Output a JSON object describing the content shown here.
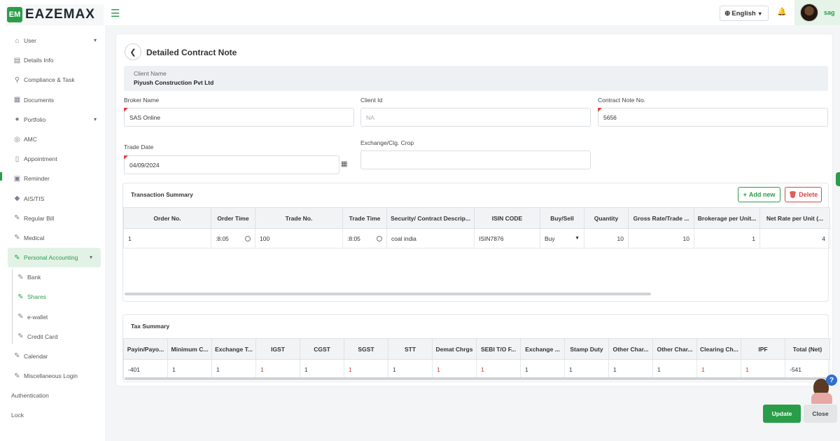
{
  "app": {
    "logo_text": "EAZEMAX",
    "logo_mark": "EM"
  },
  "sidebar": {
    "items": [
      {
        "label": "User",
        "icon": "user-home-icon"
      },
      {
        "label": "Details Info",
        "icon": "id-card-icon"
      },
      {
        "label": "Compliance & Task",
        "icon": "compliance-icon"
      },
      {
        "label": "Documents",
        "icon": "documents-icon"
      },
      {
        "label": "Portfolio",
        "icon": "user-icon"
      },
      {
        "label": "AMC",
        "icon": "amc-icon"
      },
      {
        "label": "Appointment",
        "icon": "appointment-icon"
      },
      {
        "label": "Reminder",
        "icon": "reminder-icon"
      },
      {
        "label": "AIS/TIS",
        "icon": "tag-icon"
      },
      {
        "label": "Regular Bill",
        "icon": "user-edit-icon"
      },
      {
        "label": "Medical",
        "icon": "user-edit-icon"
      },
      {
        "label": "Personal Accounting",
        "icon": "user-edit-icon"
      }
    ],
    "sub_items": [
      {
        "label": "Bank"
      },
      {
        "label": "Shares"
      },
      {
        "label": "e-wallet"
      },
      {
        "label": "Credit Card"
      }
    ],
    "bottom_items": [
      {
        "label": "Calendar"
      },
      {
        "label": "Miscellaneous Login"
      },
      {
        "label": "Authentication"
      },
      {
        "label": "Lock"
      }
    ]
  },
  "header": {
    "language": "English",
    "username": "sag"
  },
  "page": {
    "title": "Detailed Contract Note",
    "client_name_label": "Client Name",
    "client_name": "Piyush Construction Pvt Ltd"
  },
  "form": {
    "broker_name_label": "Broker Name",
    "broker_name": "SAS Online",
    "client_id_label": "Client Id",
    "client_id_placeholder": "NA",
    "contract_note_label": "Contract Note No.",
    "contract_note": "5656",
    "trade_date_label": "Trade Date",
    "trade_date": "04/09/2024",
    "exchange_label": "Exchange/Clg. Crop",
    "exchange": ""
  },
  "transaction_summary": {
    "title": "Transaction Summary",
    "add_label": "Add new",
    "delete_label": "Delete",
    "columns": [
      "Order No.",
      "Order Time",
      "Trade No.",
      "Trade Time",
      "Security/ Contract Descrip...",
      "ISIN CODE",
      "Buy/Sell",
      "Quantity",
      "Gross Rate/Trade ...",
      "Brokerage per Unit...",
      "Net Rate per Unit (..."
    ],
    "rows": [
      [
        "1",
        ":8:05",
        "100",
        ":8:05",
        "coal india",
        "ISIN7876",
        "Buy",
        "10",
        "10",
        "1",
        "4"
      ]
    ]
  },
  "tax_summary": {
    "title": "Tax Summary",
    "columns": [
      "Payin/Payo...",
      "Minimum C...",
      "Exchange T...",
      "IGST",
      "CGST",
      "SGST",
      "STT",
      "Demat Chrgs",
      "SEBI T/O F...",
      "Exchange ...",
      "Stamp Duty",
      "Other Char...",
      "Other Char...",
      "Clearing Ch...",
      "IPF",
      "Total (Net)"
    ],
    "rows": [
      [
        "-401",
        "1",
        "1",
        "1",
        "1",
        "1",
        "1",
        "1",
        "1",
        "1",
        "1",
        "1",
        "1",
        "1",
        "1",
        "-541"
      ]
    ]
  },
  "footer": {
    "update_label": "Update",
    "close_label": "Close"
  },
  "colors": {
    "accent": "#2a9d48",
    "danger": "#e14343",
    "help": "#2f6fd1"
  }
}
